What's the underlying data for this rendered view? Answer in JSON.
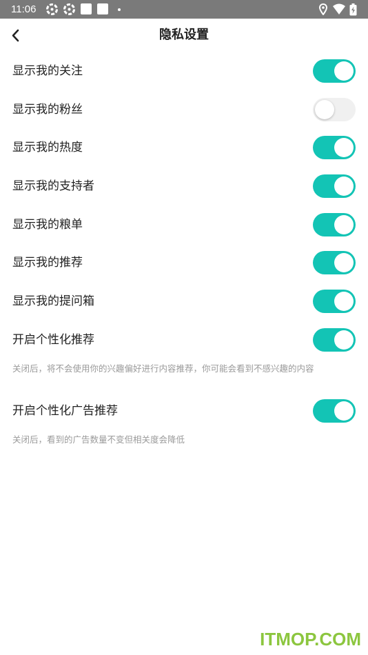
{
  "status_bar": {
    "time": "11:06",
    "icons": [
      "settings-icon",
      "settings-icon",
      "square-icon",
      "square-icon",
      "dot-icon",
      "location-icon",
      "wifi-icon",
      "battery-icon"
    ]
  },
  "header": {
    "back_icon": "chevron-left-icon",
    "title": "隐私设置"
  },
  "settings": [
    {
      "label": "显示我的关注",
      "enabled": true
    },
    {
      "label": "显示我的粉丝",
      "enabled": false
    },
    {
      "label": "显示我的热度",
      "enabled": true
    },
    {
      "label": "显示我的支持者",
      "enabled": true
    },
    {
      "label": "显示我的粮单",
      "enabled": true
    },
    {
      "label": "显示我的推荐",
      "enabled": true
    },
    {
      "label": "显示我的提问箱",
      "enabled": true
    },
    {
      "label": "开启个性化推荐",
      "enabled": true,
      "description": "关闭后，将不会使用你的兴趣偏好进行内容推荐，你可能会看到不感兴趣的内容"
    },
    {
      "label": "开启个性化广告推荐",
      "enabled": true,
      "description": "关闭后，看到的广告数量不变但相关度会降低"
    }
  ],
  "colors": {
    "toggle_on": "#13c4b5",
    "toggle_off": "#f0f0f0",
    "status_bar": "#7a7a7a",
    "watermark": "#8cc63f"
  },
  "watermark": "ITMOP.COM"
}
